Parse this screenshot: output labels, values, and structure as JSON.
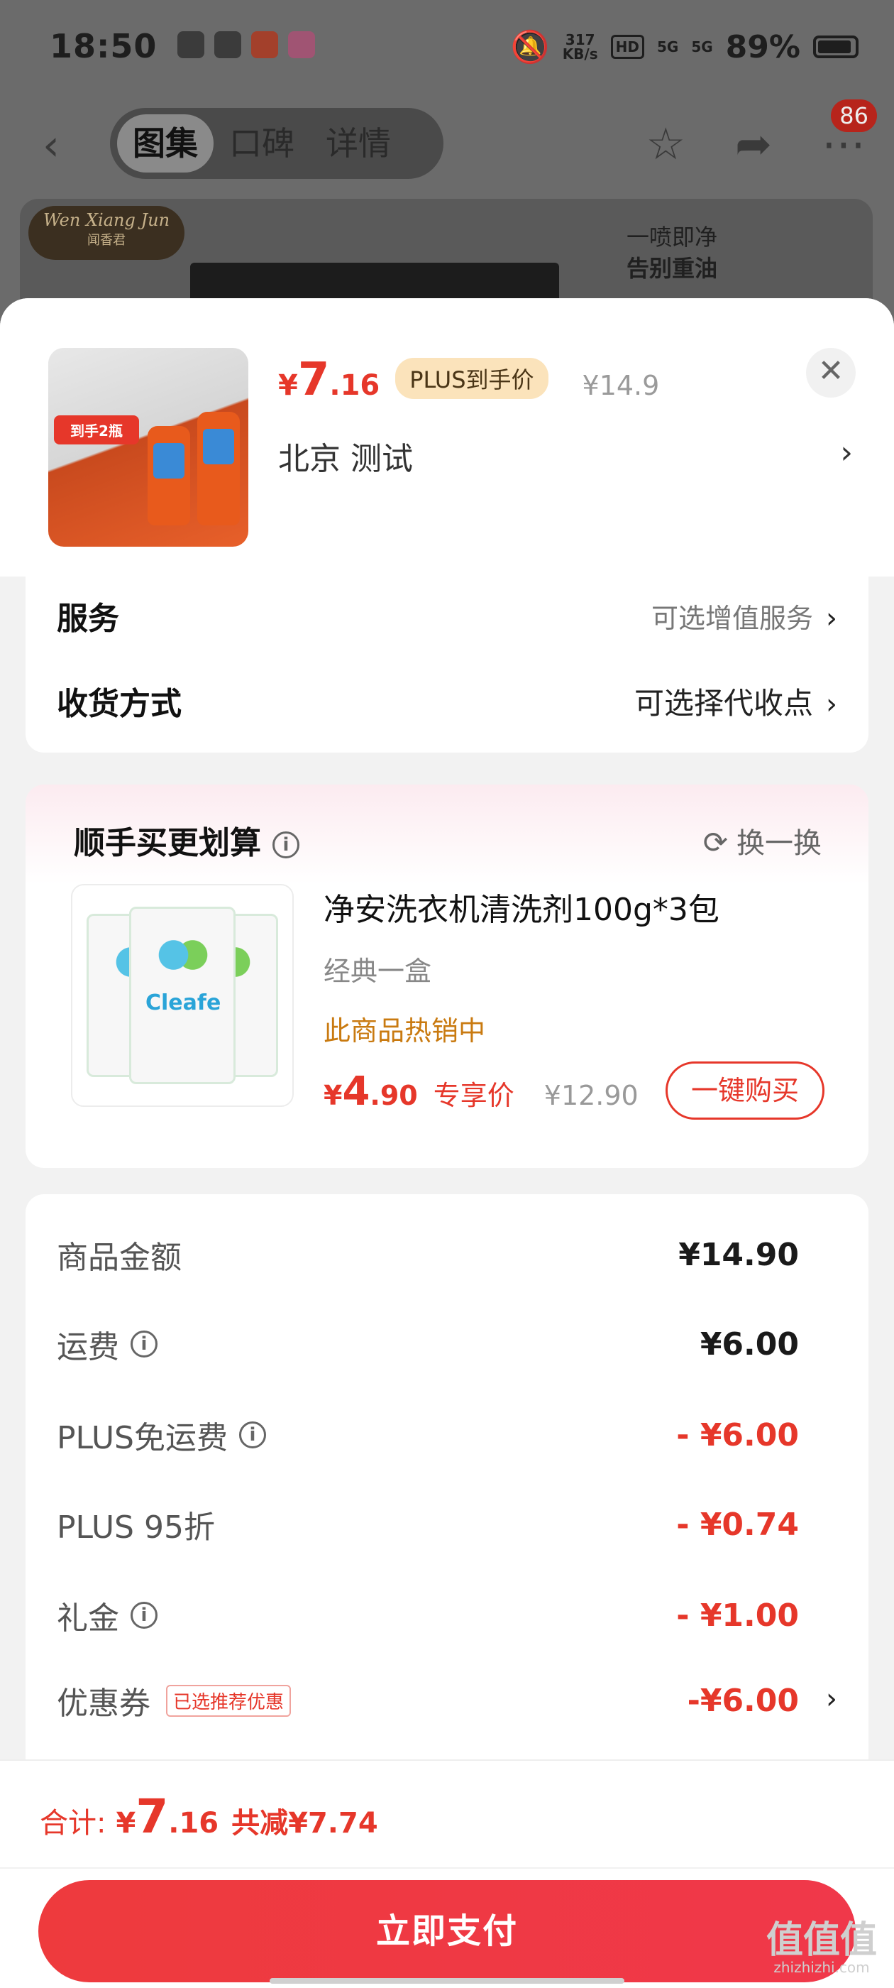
{
  "status_bar": {
    "time": "18:50",
    "hd": "HD",
    "network": "5G",
    "speed": "317",
    "speed_unit": "KB/s",
    "battery": "89%"
  },
  "nav": {
    "tabs": [
      "图集",
      "口碑",
      "详情"
    ],
    "active_tab": 0,
    "badge": "86"
  },
  "banner": {
    "brand": "Wen Xiang Jun",
    "brand_cn": "闻香君",
    "line1": "一喷即净",
    "line2": "告别重油"
  },
  "product": {
    "price_currency": "¥",
    "price_int": "7",
    "price_dec": ".16",
    "plus_tag": "PLUS到手价",
    "original_price": "¥14.9",
    "address": "北京  测试",
    "thumb_label": "到手2瓶"
  },
  "service": {
    "service_label": "服务",
    "service_value": "可选增值服务",
    "delivery_label": "收货方式",
    "delivery_value": "可选择代收点"
  },
  "upsell": {
    "title": "顺手买更划算",
    "refresh_label": "换一换",
    "product_name": "净安洗衣机清洗剂100g*3包",
    "spec": "经典一盒",
    "hot_text": "此商品热销中",
    "price_currency": "¥",
    "price_int": "4",
    "price_dec": ".90",
    "price_tag": "专享价",
    "original_price": "¥12.90",
    "buy_button": "一键购买",
    "brand_logo": "Cleafe"
  },
  "fees": [
    {
      "label": "商品金额",
      "value": "¥14.90",
      "info": false,
      "red": false
    },
    {
      "label": "运费",
      "value": "¥6.00",
      "info": true,
      "red": false
    },
    {
      "label": "PLUS免运费",
      "value": "- ¥6.00",
      "info": true,
      "red": true
    },
    {
      "label": "PLUS 95折",
      "value": "- ¥0.74",
      "info": false,
      "red": true
    },
    {
      "label": "礼金",
      "value": "- ¥1.00",
      "info": true,
      "red": true
    },
    {
      "label": "优惠券",
      "value": "-¥6.00",
      "info": false,
      "red": true
    }
  ],
  "coupon_tag": "已选推荐优惠",
  "footer": {
    "total_label": "合计:",
    "total_currency": "¥",
    "total_int": "7",
    "total_dec": ".16",
    "saved": "共减¥7.74",
    "pay_button": "立即支付"
  },
  "watermark": {
    "text": "值值值",
    "site": "zhizhizhi.com"
  },
  "colors": {
    "accent_red": "#e6372a",
    "plus_gold": "#fbe3bb",
    "hot_orange": "#c97a10"
  }
}
